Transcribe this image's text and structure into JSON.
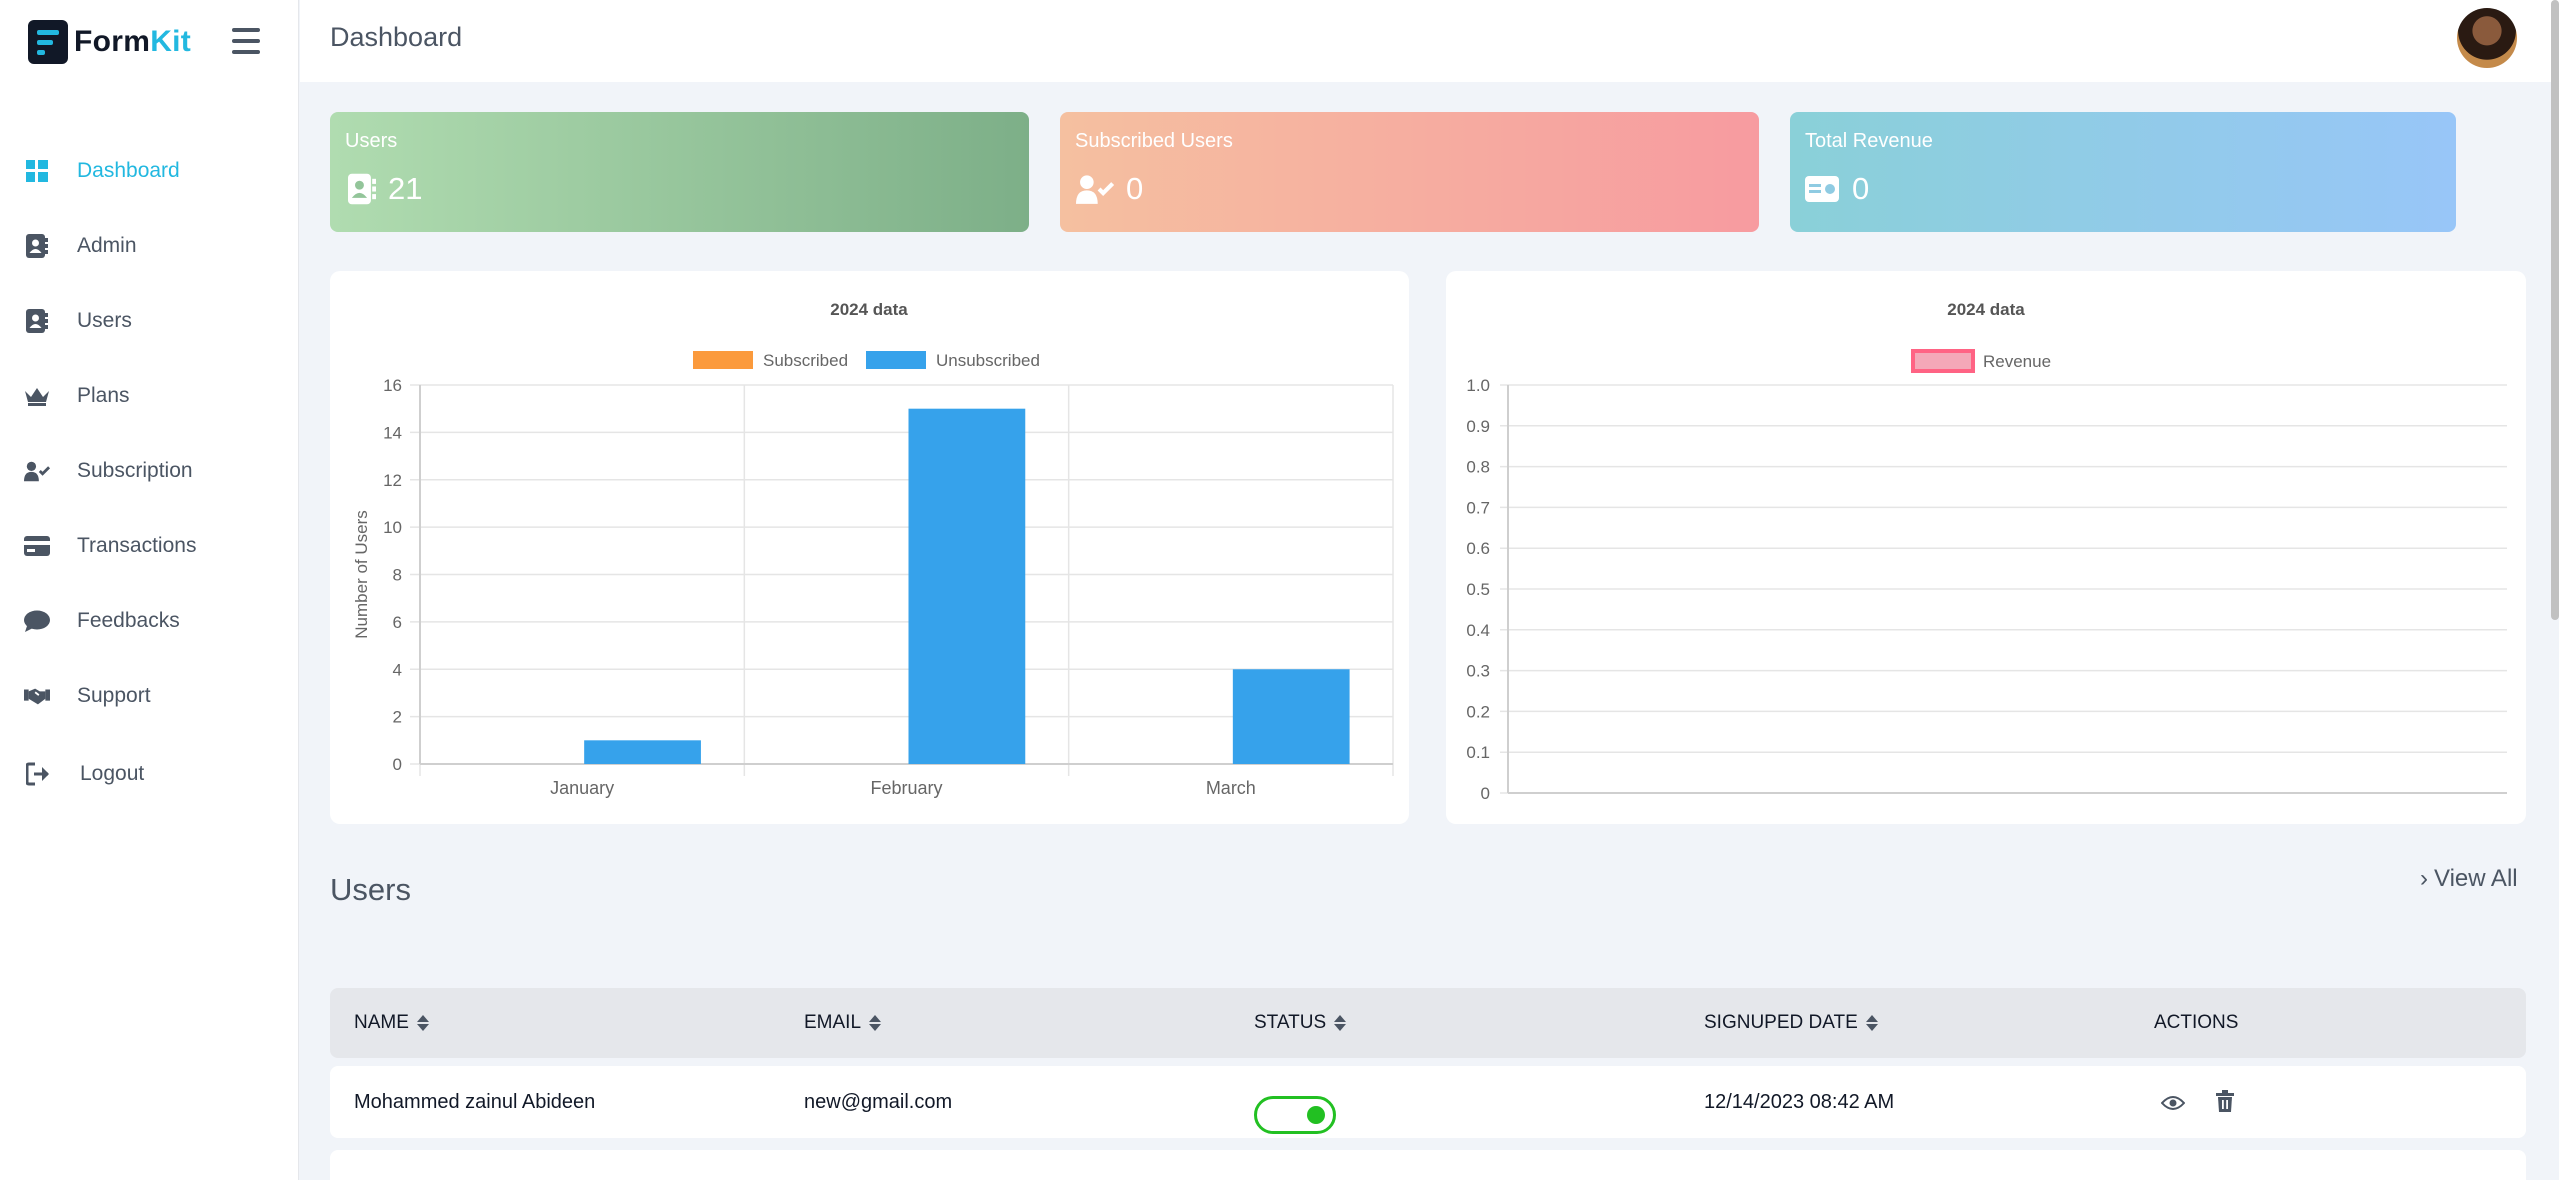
{
  "app": {
    "name_part1": "Form",
    "name_part2": "Kit"
  },
  "header": {
    "title": "Dashboard"
  },
  "sidebar": {
    "items": [
      {
        "label": "Dashboard",
        "icon": "dashboard-grid-icon",
        "active": true
      },
      {
        "label": "Admin",
        "icon": "address-book-icon"
      },
      {
        "label": "Users",
        "icon": "address-book-icon"
      },
      {
        "label": "Plans",
        "icon": "crown-icon"
      },
      {
        "label": "Subscription",
        "icon": "user-check-icon"
      },
      {
        "label": "Transactions",
        "icon": "credit-card-icon"
      },
      {
        "label": "Feedbacks",
        "icon": "comment-icon"
      },
      {
        "label": "Support",
        "icon": "handshake-icon"
      },
      {
        "label": "Logout",
        "icon": "logout-icon"
      }
    ],
    "active_color": "#22b8e0"
  },
  "stats": {
    "users": {
      "label": "Users",
      "value": "21"
    },
    "subscribed": {
      "label": "Subscribed Users",
      "value": "0"
    },
    "revenue": {
      "label": "Total Revenue",
      "value": "0"
    }
  },
  "chart_data": [
    {
      "type": "bar",
      "title": "2024 data",
      "categories": [
        "January",
        "February",
        "March"
      ],
      "series": [
        {
          "name": "Subscribed",
          "values": [
            0,
            0,
            0
          ],
          "color": "#fb9a3c"
        },
        {
          "name": "Unsubscribed",
          "values": [
            1,
            15,
            4
          ],
          "color": "#36a2eb"
        }
      ],
      "xlabel": "",
      "ylabel": "Number of Users",
      "ylim": [
        0,
        16
      ],
      "yticks": [
        0,
        2,
        4,
        6,
        8,
        10,
        12,
        14,
        16
      ],
      "grid": true,
      "legend": "top-center"
    },
    {
      "type": "line",
      "title": "2024 data",
      "categories": [],
      "series": [
        {
          "name": "Revenue",
          "values": [],
          "color": "#ff6384"
        }
      ],
      "xlabel": "",
      "ylabel": "",
      "ylim": [
        0,
        1
      ],
      "yticks": [
        "0",
        "0.1",
        "0.2",
        "0.3",
        "0.4",
        "0.5",
        "0.6",
        "0.7",
        "0.8",
        "0.9",
        "1.0"
      ],
      "grid": true,
      "legend": "top-center"
    }
  ],
  "users_section": {
    "title": "Users",
    "view_all": "View All",
    "columns": [
      "NAME",
      "EMAIL",
      "STATUS",
      "SIGNUPED DATE",
      "ACTIONS"
    ],
    "rows": [
      {
        "name": "Mohammed zainul Abideen",
        "email": "new@gmail.com",
        "status": "active",
        "date": "12/14/2023 08:42 AM"
      }
    ]
  }
}
